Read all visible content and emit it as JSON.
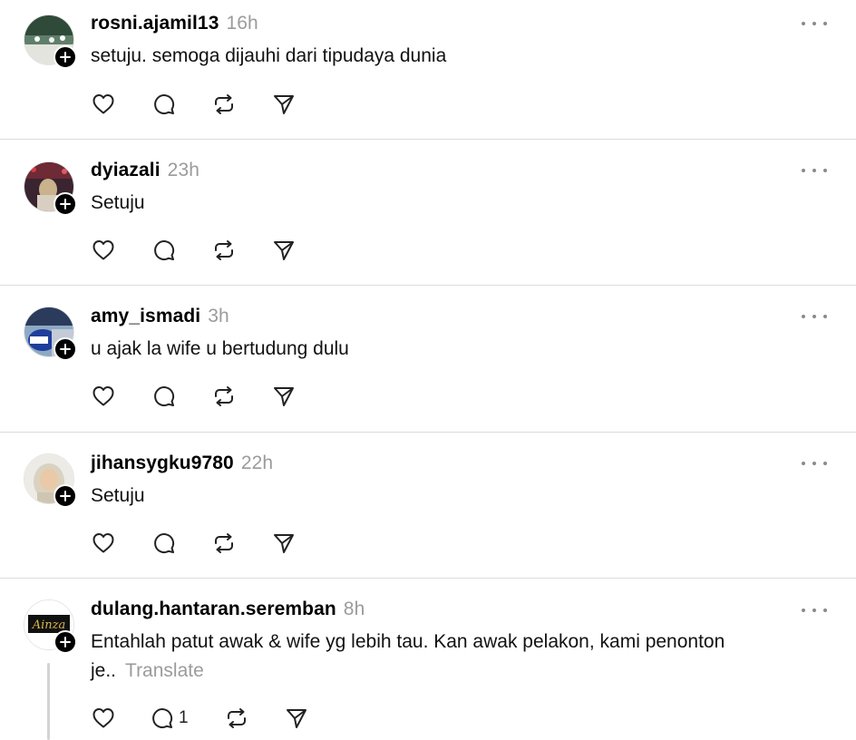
{
  "posts": [
    {
      "username": "rosni.ajamil13",
      "time": "16h",
      "text": "setuju. semoga dijauhi dari tipudaya dunia",
      "translate": "",
      "reply_count": ""
    },
    {
      "username": "dyiazali",
      "time": "23h",
      "text": "Setuju",
      "translate": "",
      "reply_count": ""
    },
    {
      "username": "amy_ismadi",
      "time": "3h",
      "text": "u ajak la wife u bertudung dulu",
      "translate": "",
      "reply_count": ""
    },
    {
      "username": "jihansygku9780",
      "time": "22h",
      "text": "Setuju",
      "translate": "",
      "reply_count": ""
    },
    {
      "username": "dulang.hantaran.seremban",
      "time": "8h",
      "text_line1": "Entahlah patut awak & wife yg lebih tau. Kan awak pelakon, kami penonton",
      "text_line2": "je..",
      "translate": "Translate",
      "reply_count": "1",
      "avatar_text": "Ainza"
    }
  ],
  "icons": {
    "like": "heart-icon",
    "reply": "comment-icon",
    "repost": "repost-icon",
    "share": "send-icon",
    "more": "more-horizontal-icon",
    "follow": "plus-icon"
  }
}
